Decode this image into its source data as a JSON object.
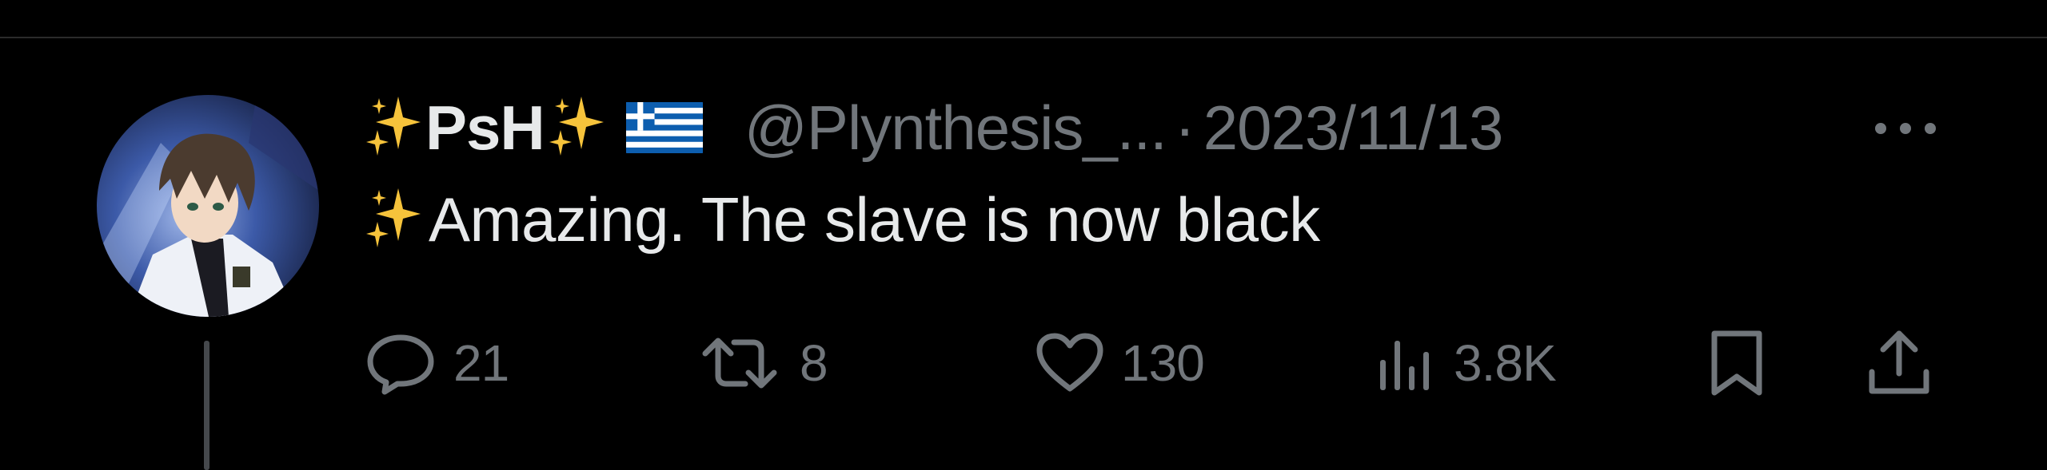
{
  "tweet": {
    "display_name": "PsH",
    "handle": "@Plynthesis_...",
    "separator": "·",
    "date": "2023/11/13",
    "text": "Amazing. The slave is now black",
    "more_icon": "ellipsis-icon",
    "name_emoji": [
      "sparkles-icon",
      "sparkles-icon",
      "greece-flag-icon"
    ],
    "text_emoji": "sparkles-icon"
  },
  "actions": {
    "reply_count": "21",
    "retweet_count": "8",
    "like_count": "130",
    "views_count": "3.8K"
  },
  "colors": {
    "background": "#000000",
    "primary_text": "#e7e9ea",
    "secondary_text": "#71767b",
    "sparkle": "#f6c33b"
  }
}
